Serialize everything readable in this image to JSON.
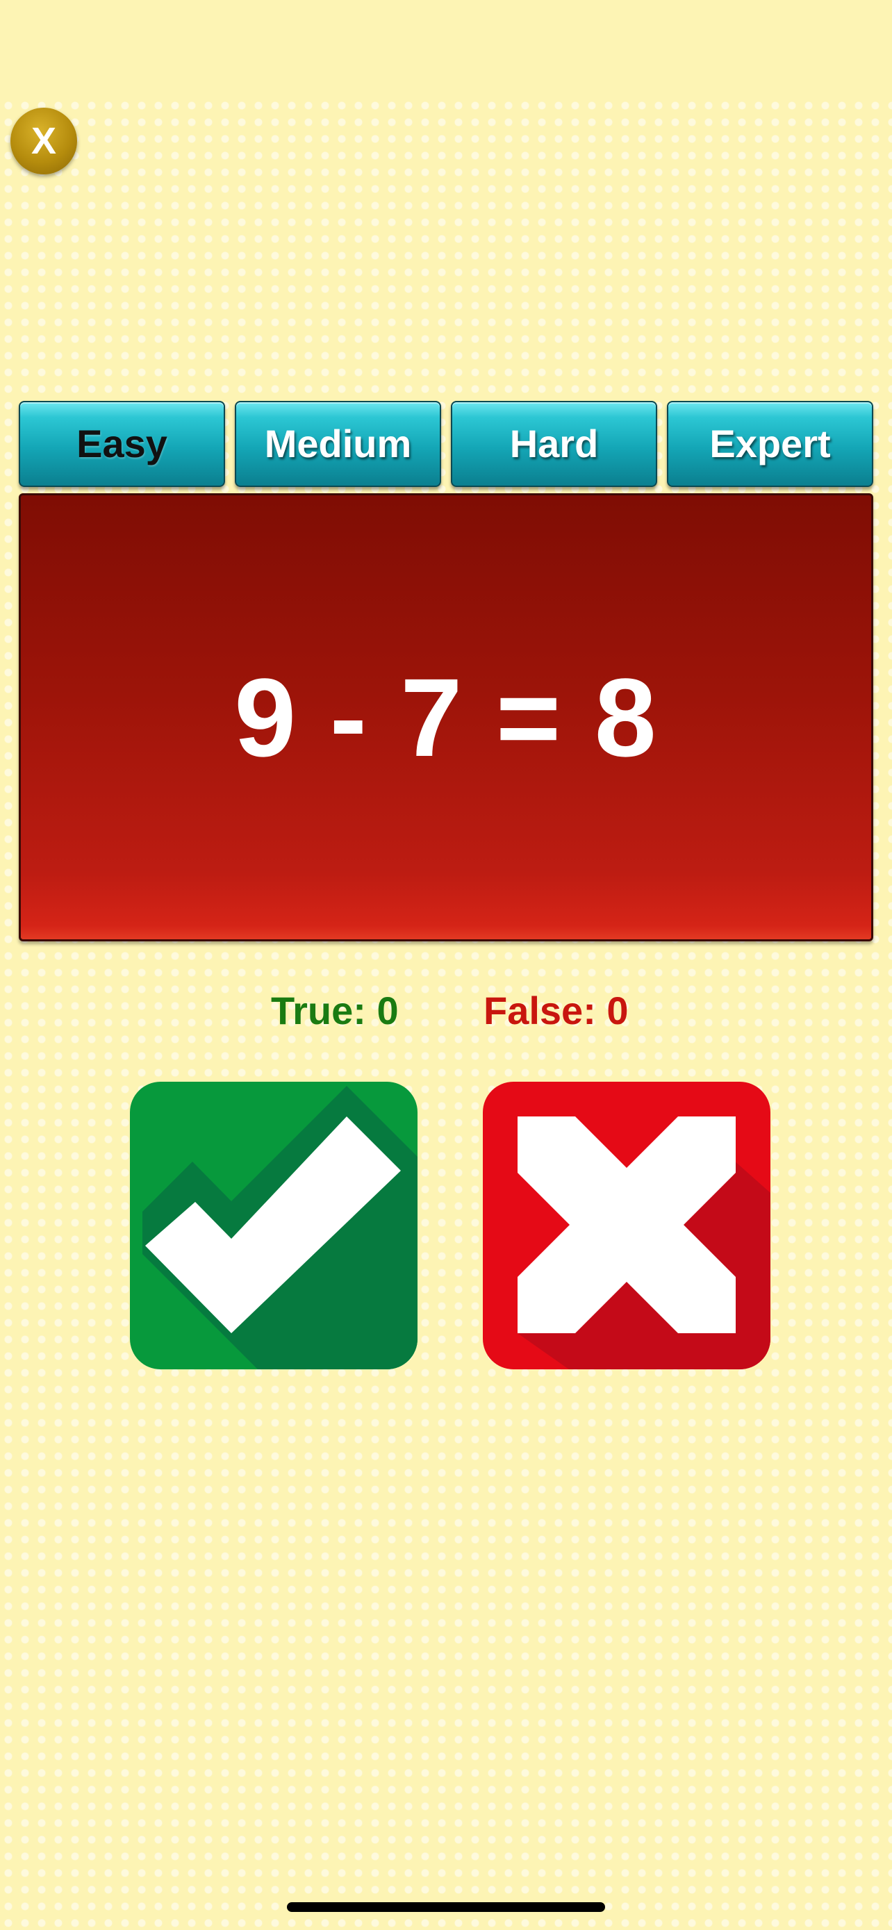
{
  "close_button": {
    "label": "X"
  },
  "difficulty_tabs": [
    {
      "label": "Easy",
      "active": true
    },
    {
      "label": "Medium",
      "active": false
    },
    {
      "label": "Hard",
      "active": false
    },
    {
      "label": "Expert",
      "active": false
    }
  ],
  "equation": {
    "text": "9 - 7 = 8"
  },
  "score": {
    "true_label": "True: 0",
    "false_label": "False: 0"
  },
  "answer_buttons": {
    "true_icon": "checkmark-icon",
    "false_icon": "cross-icon"
  },
  "colors": {
    "background": "#fdf4b4",
    "tab": "#14a6b6",
    "panel": "#9d1409",
    "true_green": "#07993c",
    "false_red": "#e50a16",
    "true_text": "#1a7b12",
    "false_text": "#c8160e",
    "close_gold": "#b58c0d"
  }
}
